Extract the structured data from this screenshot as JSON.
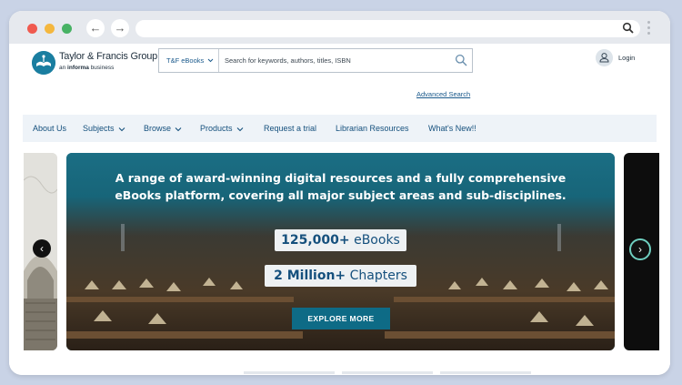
{
  "browser": {
    "back_glyph": "←",
    "forward_glyph": "→",
    "url": ""
  },
  "header": {
    "logo_name": "Taylor & Francis Group",
    "logo_sub_prefix": "an ",
    "logo_sub_brand": "informa",
    "logo_sub_suffix": " business",
    "search_scope": "T&F eBooks",
    "search_placeholder": "Search for keywords, authors, titles, ISBN",
    "advanced_search": "Advanced Search",
    "login": "Login"
  },
  "nav": {
    "items": [
      {
        "label": "About Us",
        "dropdown": false
      },
      {
        "label": "Subjects",
        "dropdown": true
      },
      {
        "label": "Browse",
        "dropdown": true
      },
      {
        "label": "Products",
        "dropdown": true
      },
      {
        "label": "Request a trial",
        "dropdown": false
      },
      {
        "label": "Librarian Resources",
        "dropdown": false
      },
      {
        "label": "What's New!!",
        "dropdown": false
      }
    ]
  },
  "hero": {
    "headline_line1": "A range of award-winning digital resources and a fully comprehensive",
    "headline_line2": "eBooks platform, covering all major subject areas and sub-disciplines.",
    "stat1_value": "125,000+",
    "stat1_label": " eBooks",
    "stat2_value": "2 Million+",
    "stat2_label": " Chapters",
    "cta": "EXPLORE MORE",
    "prev_glyph": "‹",
    "next_glyph": "›"
  },
  "colors": {
    "brand_blue": "#15507d",
    "teal": "#0e6b86",
    "nav_bg": "#eef3f8"
  }
}
